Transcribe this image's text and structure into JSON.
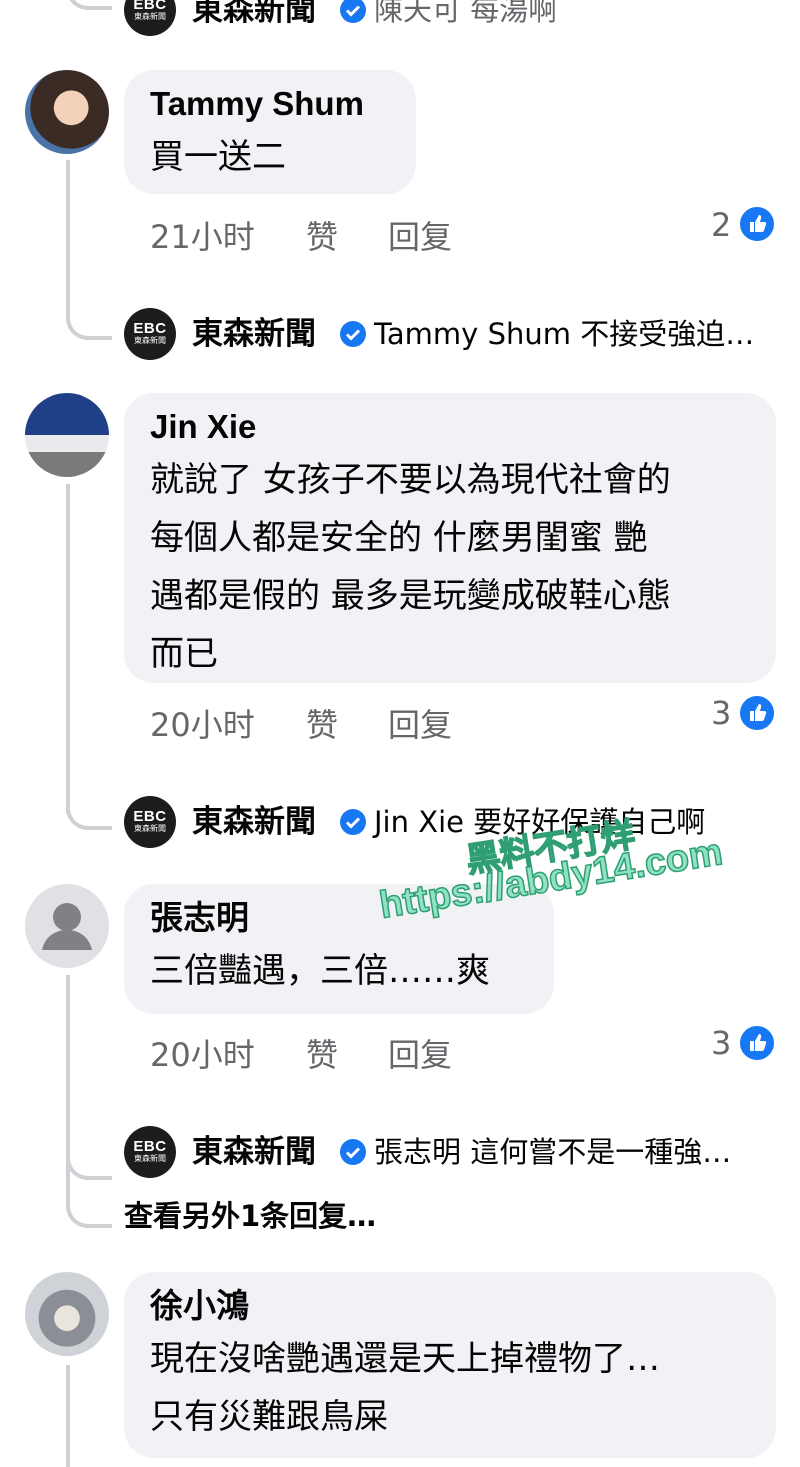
{
  "top_reply": {
    "name": "東森新聞",
    "text": "陳天可 每湯啊"
  },
  "comments": [
    {
      "author": "Tammy Shum",
      "lines": [
        "買一送二"
      ],
      "time": "21小时",
      "like_label": "赞",
      "reply_label": "回复",
      "reactions": "2",
      "page_reply": {
        "name": "東森新聞",
        "text": "Tammy Shum 不接受強迫…"
      }
    },
    {
      "author": "Jin Xie",
      "lines": [
        "就說了 女孩子不要以為現代社會的",
        "每個人都是安全的 什麼男閨蜜 艷",
        "遇都是假的 最多是玩變成破鞋心態",
        "而已"
      ],
      "time": "20小时",
      "like_label": "赞",
      "reply_label": "回复",
      "reactions": "3",
      "page_reply": {
        "name": "東森新聞",
        "text": "Jin Xie 要好好保護自己啊"
      }
    },
    {
      "author": "張志明",
      "lines": [
        "三倍豔遇，三倍……爽"
      ],
      "time": "20小时",
      "like_label": "赞",
      "reply_label": "回复",
      "reactions": "3",
      "page_reply": {
        "name": "東森新聞",
        "text": "張志明 這何嘗不是一種強…"
      },
      "more_replies": "查看另外1条回复…"
    },
    {
      "author": "徐小鴻",
      "lines": [
        "現在沒啥艷遇還是天上掉禮物了…",
        "只有災難跟鳥屎"
      ]
    }
  ],
  "page_logo": {
    "top": "EBC",
    "bottom": "東森新聞"
  },
  "watermark": {
    "line1": "黑料不打烊",
    "line2": "https://abdy14.com"
  },
  "colors": {
    "bubble": "#f0f2f5",
    "meta": "#65676b",
    "like": "#1877f2",
    "thread_line": "#ced0d4"
  },
  "icons": [
    "like-icon",
    "verified-icon",
    "default-avatar-icon"
  ]
}
